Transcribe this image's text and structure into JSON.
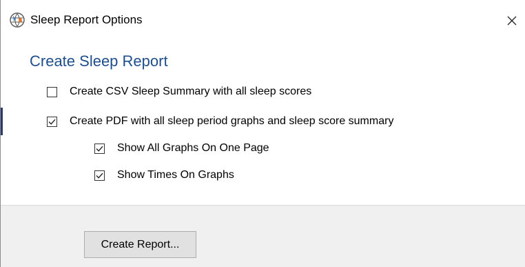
{
  "window": {
    "title": "Sleep Report Options",
    "app_icon": "globe-icon",
    "close_icon": "close-icon"
  },
  "section": {
    "heading": "Create Sleep Report",
    "heading_color": "#1f4e8c"
  },
  "options": [
    {
      "label": "Create CSV Sleep Summary with all sleep scores",
      "checked": false
    },
    {
      "label": "Create PDF with all sleep period graphs and sleep score summary",
      "checked": true
    },
    {
      "label": "Show All Graphs On One Page",
      "checked": true
    },
    {
      "label": "Show Times On Graphs",
      "checked": true
    }
  ],
  "footer": {
    "create_button_label": "Create Report..."
  }
}
